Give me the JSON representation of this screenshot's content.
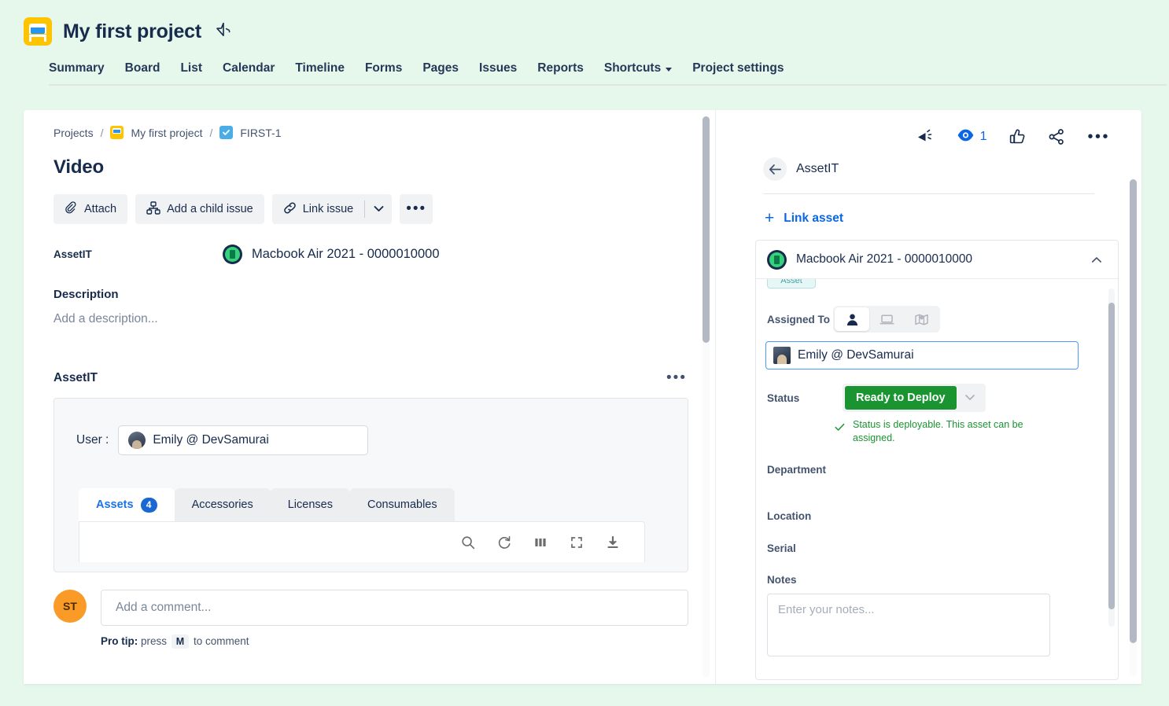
{
  "header": {
    "project_title": "My first project",
    "star_icon": "star-outline-icon",
    "project_avatar_icon": "project-avatar-icon",
    "nav_tabs": [
      {
        "label": "Summary"
      },
      {
        "label": "Board"
      },
      {
        "label": "List"
      },
      {
        "label": "Calendar"
      },
      {
        "label": "Timeline"
      },
      {
        "label": "Forms"
      },
      {
        "label": "Pages"
      },
      {
        "label": "Issues"
      },
      {
        "label": "Reports"
      },
      {
        "label": "Shortcuts",
        "has_caret": true
      },
      {
        "label": "Project settings"
      }
    ]
  },
  "left": {
    "breadcrumb": {
      "projects": "Projects",
      "sep": "/",
      "project": "My first project",
      "issue_key": "FIRST-1"
    },
    "issue_title": "Video",
    "actions": {
      "attach": "Attach",
      "attach_icon": "paperclip-icon",
      "add_child": "Add a child issue",
      "add_child_icon": "child-issue-icon",
      "link_issue": "Link issue",
      "link_issue_icon": "link-icon",
      "caret_icon": "chevron-down-icon",
      "more_icon": "more-options-icon",
      "more": "•••"
    },
    "asset_field": {
      "label": "AssetIT",
      "value": "Macbook Air 2021 - 0000010000",
      "icon": "asset-battery-icon"
    },
    "description": {
      "heading": "Description",
      "placeholder": "Add a description..."
    },
    "assetit_section": {
      "heading": "AssetIT",
      "more": "•••",
      "user_label": "User :",
      "user_value": "Emily @ DevSamurai",
      "tabs": [
        {
          "label": "Assets",
          "badge": "4",
          "active": true
        },
        {
          "label": "Accessories",
          "badge": "",
          "active": false
        },
        {
          "label": "Licenses",
          "badge": "",
          "active": false
        },
        {
          "label": "Consumables",
          "badge": "",
          "active": false
        }
      ],
      "toolbar_icons": [
        "search-icon",
        "refresh-icon",
        "columns-icon",
        "fullscreen-icon",
        "download-icon"
      ]
    },
    "comment": {
      "avatar_initials": "ST",
      "placeholder": "Add a comment...",
      "pro_tip_bold": "Pro tip:",
      "pro_tip_pre": "press",
      "pro_tip_key": "M",
      "pro_tip_post": "to comment"
    }
  },
  "right": {
    "toolbar": {
      "feedback_icon": "megaphone-icon",
      "watch_icon": "eye-icon",
      "watch_count": "1",
      "like_icon": "thumbs-up-icon",
      "share_icon": "share-icon",
      "more_icon": "more-options-icon",
      "more": "•••"
    },
    "back_row": {
      "back_icon": "arrow-left-icon",
      "title": "AssetIT"
    },
    "link_asset": {
      "plus": "+",
      "label": "Link asset"
    },
    "asset_card": {
      "title": "Macbook Air 2021 - 0000010000",
      "icon": "asset-battery-icon",
      "collapse_icon": "chevron-up-icon",
      "clipped_tag": "Asset",
      "assigned_to_label": "Assigned To",
      "segments": [
        {
          "icon": "person-icon",
          "active": true
        },
        {
          "icon": "laptop-icon",
          "active": false
        },
        {
          "icon": "location-map-icon",
          "active": false
        }
      ],
      "assigned_value": "Emily @ DevSamurai",
      "status_label": "Status",
      "status_value": "Ready to Deploy",
      "status_caret_icon": "chevron-down-icon",
      "status_hint": "Status is deployable. This asset can be assigned.",
      "status_hint_icon": "check-icon",
      "department_label": "Department",
      "location_label": "Location",
      "serial_label": "Serial",
      "notes_label": "Notes",
      "notes_placeholder": "Enter your notes..."
    }
  },
  "colors": {
    "page_bg": "#e6f8ec",
    "accent_blue": "#0b66e4",
    "status_green": "#1a9431",
    "avatar_orange": "#f99b26",
    "project_yellow": "#ffc400"
  }
}
